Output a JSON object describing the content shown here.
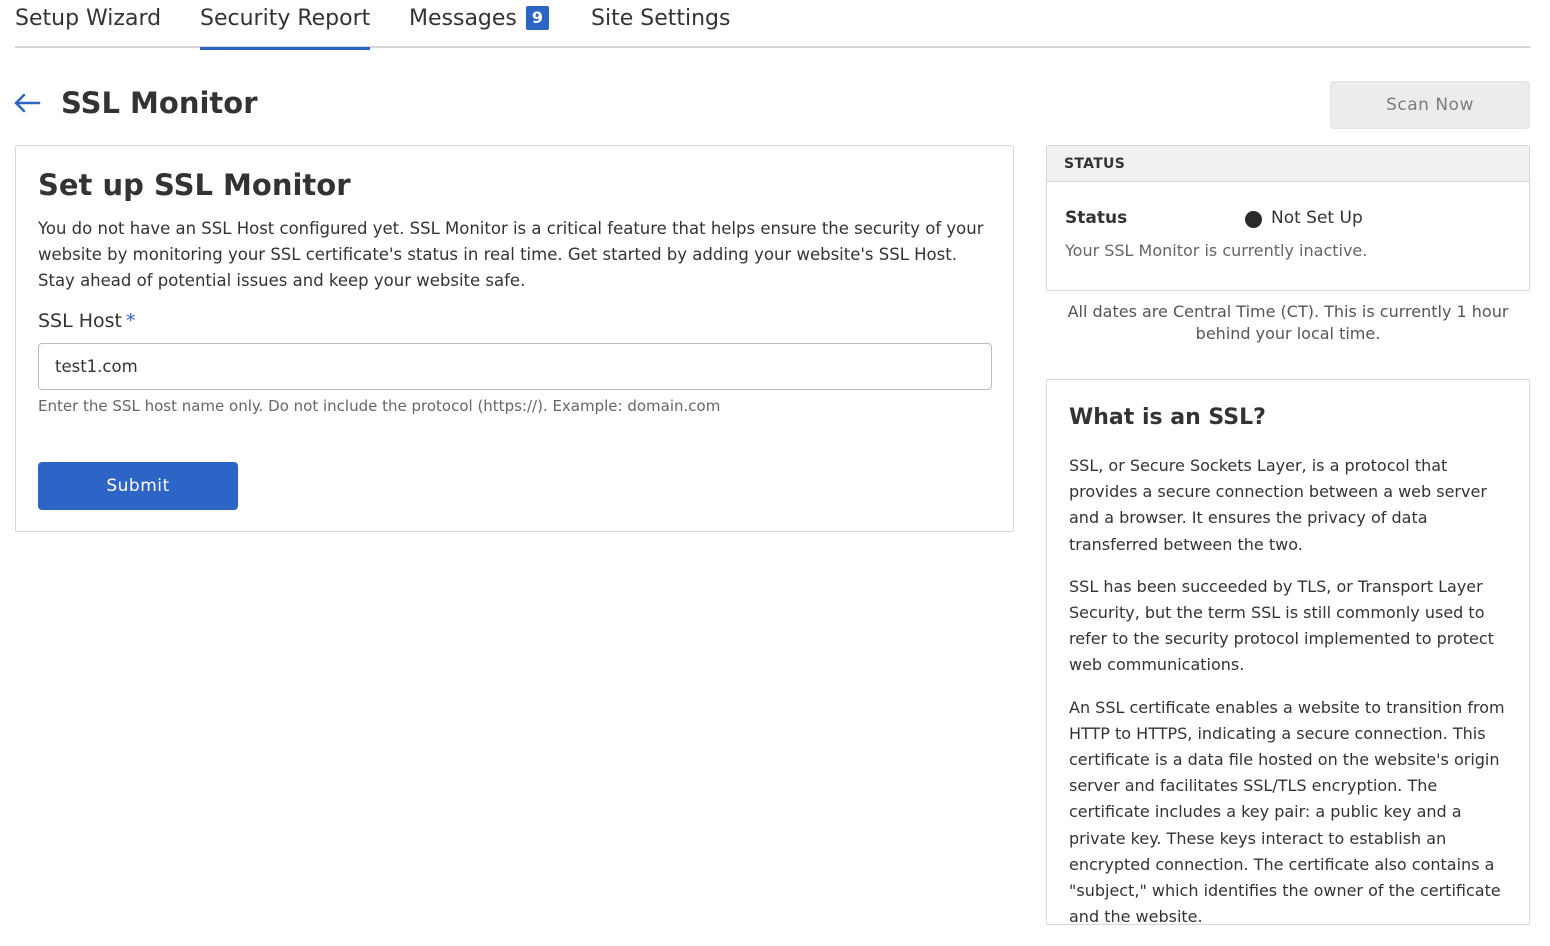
{
  "tabs": [
    {
      "label": "Setup Wizard"
    },
    {
      "label": "Security Report"
    },
    {
      "label": "Messages",
      "badge": "9"
    },
    {
      "label": "Site Settings"
    }
  ],
  "header": {
    "title": "SSL Monitor",
    "scan_button": "Scan Now"
  },
  "setup": {
    "title": "Set up SSL Monitor",
    "description": "You do not have an SSL Host configured yet. SSL Monitor is a critical feature that helps ensure the security of your website by monitoring your SSL certificate's status in real time. Get started by adding your website's SSL Host. Stay ahead of potential issues and keep your website safe.",
    "field_label": "SSL Host",
    "required_marker": "*",
    "field_value": "test1.com",
    "field_help": "Enter the SSL host name only. Do not include the protocol (https://). Example: domain.com",
    "submit_label": "Submit"
  },
  "status": {
    "heading": "STATUS",
    "key": "Status",
    "value": "Not Set Up",
    "note": "Your SSL Monitor is currently inactive."
  },
  "timezone_note": "All dates are Central Time (CT). This is currently 1 hour behind your local time.",
  "info": {
    "title": "What is an SSL?",
    "paragraphs": [
      "SSL, or Secure Sockets Layer, is a protocol that provides a secure connection between a web server and a browser. It ensures the privacy of data transferred between the two.",
      "SSL has been succeeded by TLS, or Transport Layer Security, but the term SSL is still commonly used to refer to the security protocol implemented to protect web communications.",
      "An SSL certificate enables a website to transition from HTTP to HTTPS, indicating a secure connection. This certificate is a data file hosted on the website's origin server and facilitates SSL/TLS encryption. The certificate includes a key pair: a public key and a private key. These keys interact to establish an encrypted connection. The certificate also contains a \"subject,\" which identifies the owner of the certificate and the website."
    ]
  },
  "colors": {
    "accent": "#2d65c7",
    "status_dot": "#2a2a2a"
  },
  "icons": {
    "back": "arrow-left-icon",
    "status": "status-dot-icon"
  }
}
